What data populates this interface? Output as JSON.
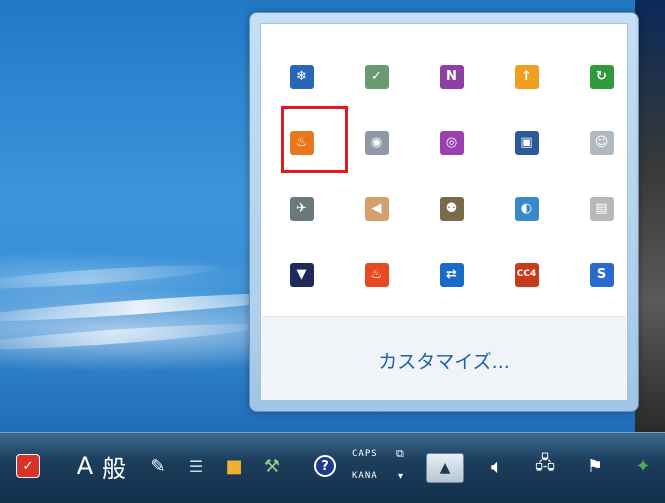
{
  "flyout": {
    "icons": [
      {
        "name": "bitlocker-icon",
        "glyph": "❄",
        "bg": "#2a66b8"
      },
      {
        "name": "network-map-icon",
        "glyph": "✓",
        "bg": "#6a9a72"
      },
      {
        "name": "onenote-icon",
        "glyph": "N",
        "bg": "#8d3fa3"
      },
      {
        "name": "update-arrow-icon",
        "glyph": "↑",
        "bg": "#f0a020"
      },
      {
        "name": "green-sync-icon",
        "glyph": "↻",
        "bg": "#2e9a3a"
      },
      {
        "name": "java-icon",
        "glyph": "♨",
        "bg": "#e8761a"
      },
      {
        "name": "webcam-icon",
        "glyph": "◉",
        "bg": "#8f9aa6"
      },
      {
        "name": "wireless-signal-icon",
        "glyph": "◎",
        "bg": "#9b3fb0"
      },
      {
        "name": "monitor-icon",
        "glyph": "▣",
        "bg": "#2a5a9a"
      },
      {
        "name": "emoticon-icon",
        "glyph": "☺",
        "bg": "#b0b8c0"
      },
      {
        "name": "satellite-icon",
        "glyph": "✈",
        "bg": "#6a7a7a"
      },
      {
        "name": "speaker-icon",
        "glyph": "◀",
        "bg": "#d4a070"
      },
      {
        "name": "users-icon",
        "glyph": "⚉",
        "bg": "#7a6a4a"
      },
      {
        "name": "eye-icon",
        "glyph": "◐",
        "bg": "#3a8ac8"
      },
      {
        "name": "keyboard-icon",
        "glyph": "▤",
        "bg": "#b8b8b8"
      },
      {
        "name": "down-circle-icon",
        "glyph": "▼",
        "bg": "#1e2a5a"
      },
      {
        "name": "flame-icon",
        "glyph": "♨",
        "bg": "#e84a20"
      },
      {
        "name": "teamviewer-icon",
        "glyph": "⇄",
        "bg": "#1a6ac8"
      },
      {
        "name": "cc4-icon",
        "glyph": "CC4",
        "bg": "#c83a1a"
      },
      {
        "name": "s-logo-icon",
        "glyph": "S",
        "bg": "#2a6ad0"
      }
    ],
    "customize_label": "カスタマイズ..."
  },
  "taskbar": {
    "ime_mode": "A",
    "ime_kanji": "般",
    "caps_label": "CAPS",
    "kana_label": "KANA",
    "help_glyph": "?",
    "show_hidden_label": "▲"
  }
}
